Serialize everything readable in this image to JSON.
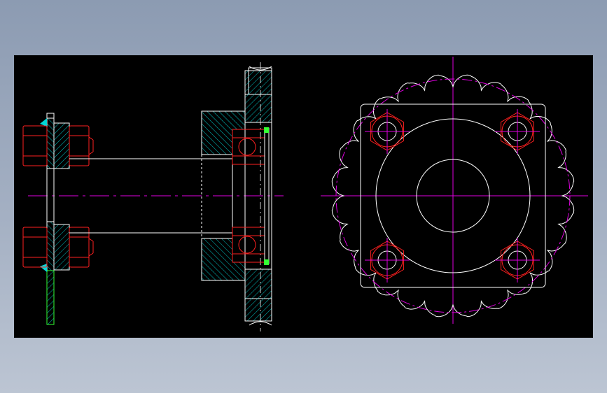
{
  "drawing": {
    "views": [
      "section-view",
      "front-view"
    ],
    "sprocket": {
      "teeth": 24
    },
    "bolt_holes": 4
  },
  "colors": {
    "background": "#000000",
    "page_background": "#a4b0c3",
    "outline": "#ffffff",
    "centerline": "#e000e0",
    "fastener": "#ff2020",
    "hatch": "#00d8d8",
    "seal": "#33ff33"
  }
}
